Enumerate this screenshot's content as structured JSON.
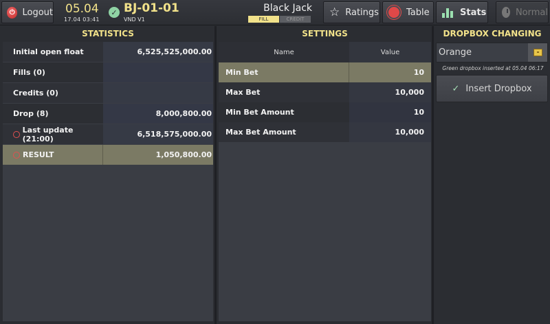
{
  "header": {
    "logout_label": "Logout",
    "date_big": "05.04",
    "date_small": "17.04 03:41",
    "table_id": "BJ-01-01",
    "currency": "VND  V1",
    "game_name": "Black Jack",
    "fill_tag": "FILL",
    "credit_tag": "CREDIT",
    "ratings_label": "Ratings",
    "table_label": "Table",
    "stats_label": "Stats",
    "normal_label": "Normal"
  },
  "statistics": {
    "title": "STATISTICS",
    "rows": [
      {
        "label": "Initial open float",
        "value": "6,525,525,000.00"
      },
      {
        "label": "Fills (0)",
        "value": ""
      },
      {
        "label": "Credits (0)",
        "value": ""
      },
      {
        "label": "Drop (8)",
        "value": "8,000,800.00"
      },
      {
        "label": "Last update (21:00)",
        "value": "6,518,575,000.00"
      },
      {
        "label": "RESULT",
        "value": "1,050,800.00"
      }
    ]
  },
  "settings": {
    "title": "SETTINGS",
    "col_name": "Name",
    "col_value": "Value",
    "rows": [
      {
        "name": "Min Bet",
        "value": "10"
      },
      {
        "name": "Max Bet",
        "value": "10,000"
      },
      {
        "name": "Min Bet Amount",
        "value": "10"
      },
      {
        "name": "Max Bet Amount",
        "value": "10,000"
      }
    ]
  },
  "dropbox": {
    "title": "DROPBOX CHANGING",
    "selected": "Orange",
    "info": "Green dropbox inserted at 05.04 06:17",
    "insert_label": "Insert Dropbox"
  },
  "colors": {
    "accent_yellow": "#f2e28a",
    "selected_row": "#7b7a64",
    "background": "#2b2d32",
    "stats_icon_green": "#9be0b0",
    "logout_red": "#e04848"
  },
  "icons": [
    "power-icon",
    "check-circle-icon",
    "star-icon",
    "record-icon",
    "bar-chart-icon",
    "clock-icon",
    "box-icon",
    "checkmark-icon"
  ]
}
